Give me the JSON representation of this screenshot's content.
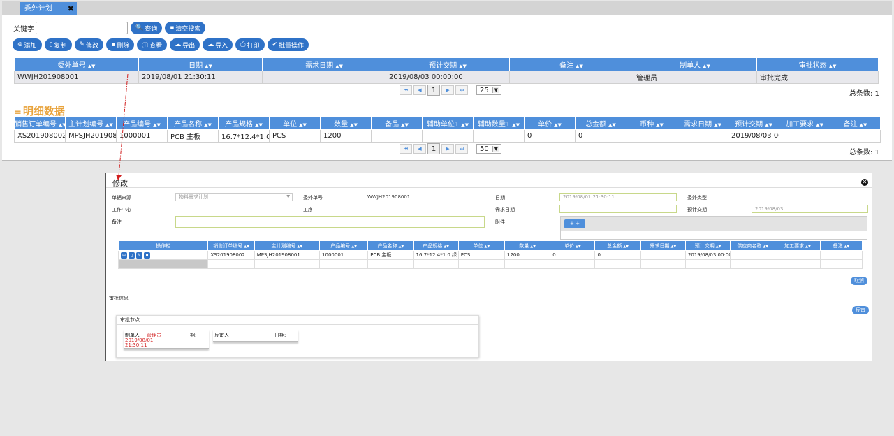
{
  "tab": {
    "label": "委外计划",
    "close": "✖"
  },
  "search": {
    "label": "关键字",
    "value": "",
    "query_btn": "查询",
    "clear_btn": "清空搜索"
  },
  "toolbar": {
    "add": "添加",
    "copy": "复制",
    "edit": "修改",
    "delete": "删除",
    "view": "查看",
    "export": "导出",
    "import": "导入",
    "print": "打印",
    "batch": "批量操作"
  },
  "plan_table": {
    "headers": [
      "委外单号",
      "日期",
      "需求日期",
      "预计交期",
      "备注",
      "制单人",
      "审批状态"
    ],
    "rows": [
      [
        "WWJH201908001",
        "2019/08/01 21:30:11",
        "",
        "2019/08/03 00:00:00",
        "",
        "管理员",
        "审批完成"
      ]
    ]
  },
  "pager1": {
    "page": "1",
    "size": "25",
    "total": "总条数: 1"
  },
  "detail_section": {
    "title": "明细数据"
  },
  "detail_table": {
    "headers": [
      "销售订单编号",
      "主计划编号",
      "产品编号",
      "产品名称",
      "产品规格",
      "单位",
      "数量",
      "备品",
      "辅助单位1",
      "辅助数量1",
      "单价",
      "总金额",
      "币种",
      "需求日期",
      "预计交期",
      "加工要求",
      "备注"
    ],
    "rows": [
      [
        "XS201908002",
        "MPSJH201908001",
        "1000001",
        "PCB 主板",
        "16.7*12.4*1.0 绿",
        "PCS",
        "1200",
        "",
        "",
        "",
        "0",
        "0",
        "",
        "",
        "2019/08/03 00:00:00",
        "",
        ""
      ]
    ]
  },
  "pager2": {
    "page": "1",
    "size": "50",
    "total": "总条数: 1"
  },
  "dialog": {
    "title": "修改",
    "fields": {
      "source_label": "单据来源",
      "source_value": "物料需求计划",
      "order_no_label": "委外单号",
      "order_no_value": "WWJH201908001",
      "date_label": "日期",
      "date_value": "2019/08/01 21:30:11",
      "type_label": "委外类型",
      "workcenter_label": "工作中心",
      "process_label": "工序",
      "need_date_label": "需求日期",
      "expected_label": "预计交期",
      "expected_value": "2019/08/03",
      "remark_label": "备注",
      "attach_label": "附件",
      "attach_btn": "+ +"
    },
    "grid": {
      "headers": [
        "操作栏",
        "销售订单编号",
        "主计划编号",
        "产品编号",
        "产品名称",
        "产品规格",
        "单位",
        "数量",
        "单价",
        "总金额",
        "需求日期",
        "预计交期",
        "供应商名称",
        "加工要求",
        "备注"
      ],
      "row": [
        "XS201908002",
        "MPSJH201908001",
        "1000001",
        "PCB 主板",
        "16.7*12.4*1.0 绿",
        "PCS",
        "1200",
        "0",
        "0",
        "",
        "2019/08/03 00:00:00",
        "",
        "",
        ""
      ]
    },
    "cancel_btn": "取消",
    "approval_label": "审批信息",
    "reject_btn": "反审",
    "approval_card": {
      "title": "审批节点",
      "node1": {
        "role": "制单人",
        "person": "管理员",
        "date_label": "日期:",
        "date": "2019/08/01",
        "time": "21:30:11"
      },
      "node2": {
        "role": "反审人",
        "date_label": "日期:"
      }
    }
  },
  "colors": {
    "header_blue": "#4f8fdb",
    "button_blue": "#2f72c7",
    "section_orange": "#e8a33c",
    "red": "#d21f1f"
  }
}
